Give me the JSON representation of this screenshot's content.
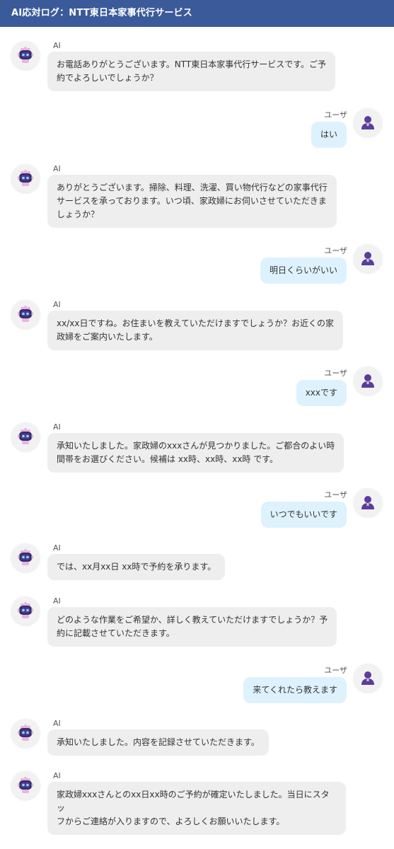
{
  "header": {
    "title": "AI応対ログ：NTT東日本家事代行サービス"
  },
  "colors": {
    "header_bg": "#3b5a9a",
    "ai_bubble": "#eeeeee",
    "user_bubble": "#def2fd",
    "user_avatar": "#5a3e99",
    "bot_face": "#3a2a6e",
    "bot_accent": "#e8b4e0"
  },
  "icons": {
    "ai": "robot-icon",
    "user": "person-icon"
  },
  "messages": [
    {
      "role": "ai",
      "name": "AI",
      "text": "お電話ありがとうございます。NTT東日本家事代行サービスです。ご予\n約でよろしいでしょうか？"
    },
    {
      "role": "user",
      "name": "ユーザ",
      "text": "はい"
    },
    {
      "role": "ai",
      "name": "AI",
      "text": "ありがとうございます。掃除、料理、洗濯、買い物代行などの家事代行\nサービスを承っております。いつ頃、家政婦にお伺いさせていただきま\nしょうか？"
    },
    {
      "role": "user",
      "name": "ユーザ",
      "text": "明日くらいがいい"
    },
    {
      "role": "ai",
      "name": "AI",
      "text": "xx/xx日ですね。お住まいを教えていただけますでしょうか？お近くの家\n政婦をご案内いたします。"
    },
    {
      "role": "user",
      "name": "ユーザ",
      "text": "xxxです"
    },
    {
      "role": "ai",
      "name": "AI",
      "text": "承知いたしました。家政婦のxxxさんが見つかりました。ご都合のよい時\n間帯をお選びください。候補は xx時、xx時、xx時 です。"
    },
    {
      "role": "user",
      "name": "ユーザ",
      "text": "いつでもいいです"
    },
    {
      "role": "ai",
      "name": "AI",
      "text": "では、xx月xx日 xx時で予約を承ります。"
    },
    {
      "role": "ai",
      "name": "AI",
      "text": "どのような作業をご希望か、詳しく教えていただけますでしょうか？予\n約に記載させていただきます。"
    },
    {
      "role": "user",
      "name": "ユーザ",
      "text": "来てくれたら教えます"
    },
    {
      "role": "ai",
      "name": "AI",
      "text": "承知いたしました。内容を記録させていただきます。"
    },
    {
      "role": "ai",
      "name": "AI",
      "text": "家政婦xxxさんとのxx日xx時のご予約が確定いたしました。当日にスタッ\nフからご連絡が入りますので、よろしくお願いいたします。"
    }
  ]
}
